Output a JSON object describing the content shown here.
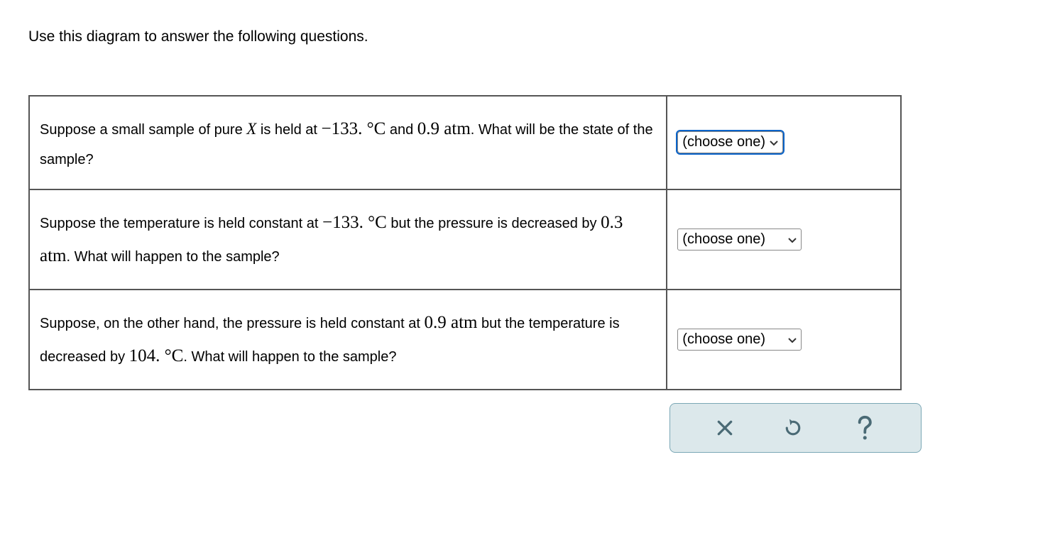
{
  "intro": "Use this diagram to answer the following questions.",
  "questions": [
    {
      "pre1": "Suppose a small sample of pure ",
      "var": "X",
      "mid1": " is held at ",
      "val1": "−133. °C",
      "mid2": " and ",
      "val2": "0.9 atm",
      "post": ". What will be the state of the sample?",
      "select_label": "(choose one)",
      "focused": true,
      "narrow": true
    },
    {
      "pre1": "Suppose the temperature is held constant at ",
      "val1": "−133. °C",
      "mid1": " but the pressure is decreased by ",
      "val2": "0.3 atm",
      "post": ". What will happen to the sample?",
      "select_label": "(choose one)",
      "focused": false,
      "narrow": false
    },
    {
      "pre1": "Suppose, on the other hand, the pressure is held constant at ",
      "val1": "0.9 atm",
      "mid1": " but the temperature is decreased by ",
      "val2": "104. °C",
      "post": ". What will happen to the sample?",
      "select_label": "(choose one)",
      "focused": false,
      "narrow": false
    }
  ],
  "toolbar": {
    "close": "close",
    "reset": "reset",
    "help": "help"
  }
}
